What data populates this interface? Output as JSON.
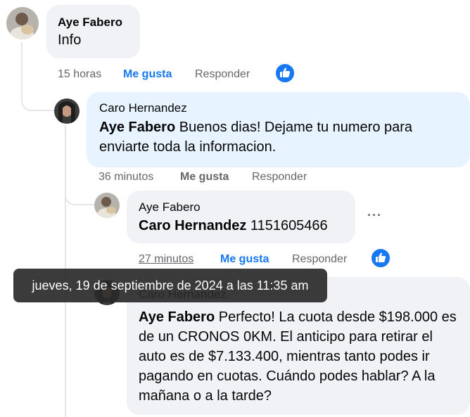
{
  "comments": [
    {
      "author": "Aye Fabero",
      "text": "Info",
      "time": "15 horas",
      "like": "Me gusta",
      "reply": "Responder"
    },
    {
      "author": "Caro Hernandez",
      "mention": "Aye Fabero",
      "text": " Buenos dias! Dejame tu numero para enviarte toda la informacion.",
      "time": "36 minutos",
      "like": "Me gusta",
      "reply": "Responder"
    },
    {
      "author": "Aye Fabero",
      "mention": "Caro Hernandez",
      "text": " 1151605466",
      "time": "27 minutos",
      "like": "Me gusta",
      "reply": "Responder"
    },
    {
      "author": "Caro Hernandez",
      "mention": "Aye Fabero",
      "text": " Perfecto! La cuota desde $198.000 es de un CRONOS 0KM. El anticipo para retirar el auto es de $7.133.400, mientras tanto podes ir pagando en cuotas. Cuándo podes hablar? A la mañana o a la tarde?"
    }
  ],
  "tooltip": "jueves, 19 de septiembre de 2024 a las 11:35 am",
  "more_options": "···",
  "colors": {
    "accent": "#1877f2",
    "bubble_gray": "#f0f2f5",
    "bubble_blue": "#e7f3ff",
    "meta_gray": "#65676b"
  }
}
